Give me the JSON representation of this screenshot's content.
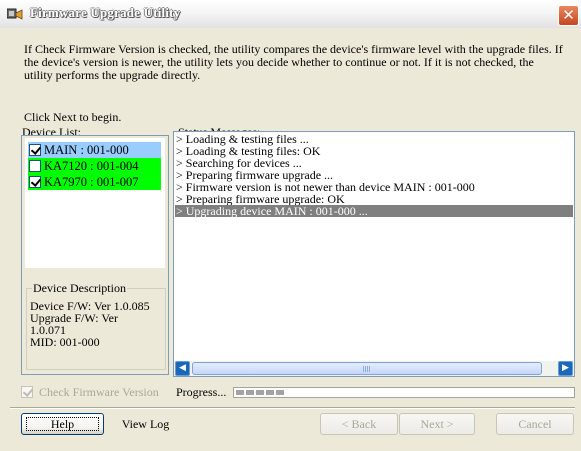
{
  "window": {
    "title": "Firmware Upgrade Utility",
    "close_label": "✕"
  },
  "info": {
    "text": "If Check Firmware Version is checked, the utility compares the device's firmware level with the upgrade files. If the device's version is newer, the utility lets you decide whether to continue or not. If it is not checked, the utility performs the upgrade directly.",
    "click_next": "Click Next to begin."
  },
  "device_list": {
    "label": "Device List:",
    "items": [
      {
        "label": "MAIN : 001-000",
        "checked": true,
        "bg": "#99ccff"
      },
      {
        "label": "KA7120 : 001-004",
        "checked": false,
        "bg": "#00ff00"
      },
      {
        "label": "KA7970 : 001-007",
        "checked": true,
        "bg": "#00ff00"
      }
    ]
  },
  "device_description": {
    "legend": "Device Description",
    "lines": [
      "Device F/W: Ver 1.0.085",
      "Upgrade F/W: Ver",
      "1.0.071",
      "MID: 001-000"
    ]
  },
  "status": {
    "label": "Status Messages:",
    "messages": [
      "> Loading & testing files ...",
      "> Loading & testing files: OK",
      "> Searching for devices ...",
      "> Preparing firmware upgrade ...",
      "> Firmware version is not newer than device MAIN : 001-000",
      "> Preparing firmware upgrade: OK",
      "> Upgrading device MAIN : 001-000 ..."
    ],
    "selected_index": 6,
    "scroll_left_icon": "◀",
    "scroll_right_icon": "▶"
  },
  "check_firmware": {
    "label": "Check Firmware Version",
    "checked": true,
    "enabled": false
  },
  "progress": {
    "label": "Progress...",
    "percent": 15
  },
  "buttons": {
    "help": "Help",
    "view_log": "View Log",
    "back": "< Back",
    "next": "Next >",
    "cancel": "Cancel"
  },
  "colors": {
    "device_main_bg": "#99ccff",
    "device_green_bg": "#00ff00",
    "selected_status_bg": "#7f7f7f",
    "title_close_bg": "#c44620"
  }
}
